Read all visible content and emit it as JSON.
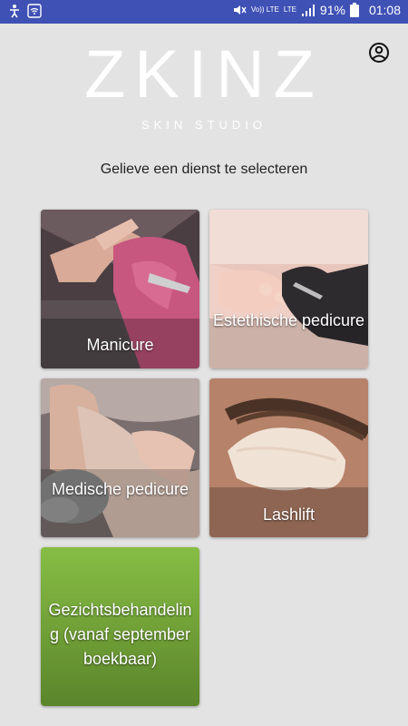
{
  "status_bar": {
    "battery": "91%",
    "time": "01:08",
    "network": "LTE",
    "volte": "Vo)) LTE"
  },
  "logo": {
    "main": "ZKINZ",
    "sub": "SKIN STUDIO"
  },
  "prompt": "Gelieve een dienst te selecteren",
  "services": [
    {
      "label": "Manicure"
    },
    {
      "label": "Estethische pedicure"
    },
    {
      "label": "Medische pedicure"
    },
    {
      "label": "Lashlift"
    },
    {
      "label": "Gezichtsbehandeling (vanaf september boekbaar)"
    }
  ],
  "colors": {
    "status_bar": "#3f51b5",
    "background": "#e3e3e3",
    "facial_tile": "#76a83a"
  }
}
